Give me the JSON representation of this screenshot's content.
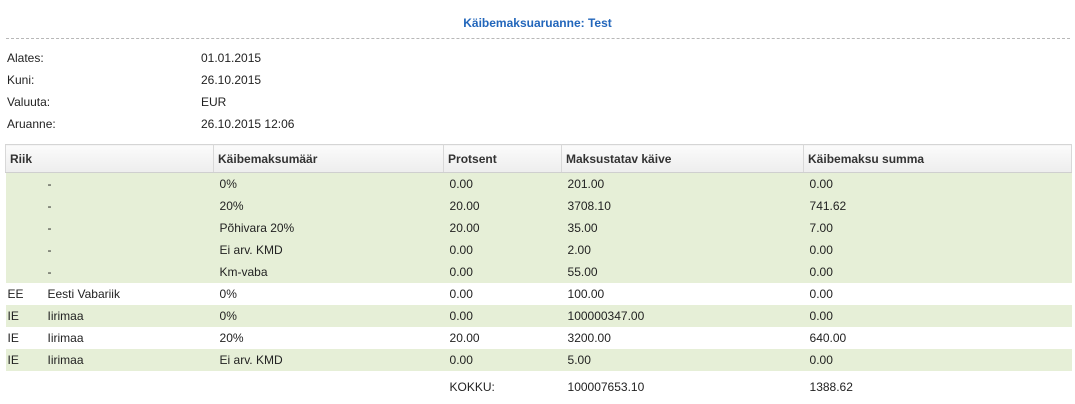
{
  "report": {
    "title": "Käibemaksuaruanne: Test"
  },
  "meta": [
    {
      "label": "Alates:",
      "value": "01.01.2015"
    },
    {
      "label": "Kuni:",
      "value": "26.10.2015"
    },
    {
      "label": "Valuuta:",
      "value": "EUR"
    },
    {
      "label": "Aruanne:",
      "value": "26.10.2015 12:06"
    }
  ],
  "table": {
    "headers": {
      "country": "Riik",
      "vat_rate": "Käibemaksumäär",
      "percent": "Protsent",
      "taxable": "Maksustatav käive",
      "vat_sum": "Käibemaksu summa"
    },
    "rows": [
      {
        "code": "",
        "name": "-",
        "rate": "0%",
        "pct": "0.00",
        "base": "201.00",
        "sum": "0.00"
      },
      {
        "code": "",
        "name": "-",
        "rate": "20%",
        "pct": "20.00",
        "base": "3708.10",
        "sum": "741.62"
      },
      {
        "code": "",
        "name": "-",
        "rate": "Põhivara 20%",
        "pct": "20.00",
        "base": "35.00",
        "sum": "7.00"
      },
      {
        "code": "",
        "name": "-",
        "rate": "Ei arv. KMD",
        "pct": "0.00",
        "base": "2.00",
        "sum": "0.00"
      },
      {
        "code": "",
        "name": "-",
        "rate": "Km-vaba",
        "pct": "0.00",
        "base": "55.00",
        "sum": "0.00"
      },
      {
        "code": "EE",
        "name": "Eesti Vabariik",
        "rate": "0%",
        "pct": "0.00",
        "base": "100.00",
        "sum": "0.00"
      },
      {
        "code": "IE",
        "name": "Iirimaa",
        "rate": "0%",
        "pct": "0.00",
        "base": "100000347.00",
        "sum": "0.00"
      },
      {
        "code": "IE",
        "name": "Iirimaa",
        "rate": "20%",
        "pct": "20.00",
        "base": "3200.00",
        "sum": "640.00"
      },
      {
        "code": "IE",
        "name": "Iirimaa",
        "rate": "Ei arv. KMD",
        "pct": "0.00",
        "base": "5.00",
        "sum": "0.00"
      }
    ],
    "total": {
      "label": "KOKKU:",
      "base": "100007653.10",
      "sum": "1388.62"
    }
  },
  "colors": {
    "title": "#2266bb",
    "row_green": "#e6efd7",
    "row_white": "#ffffff"
  }
}
